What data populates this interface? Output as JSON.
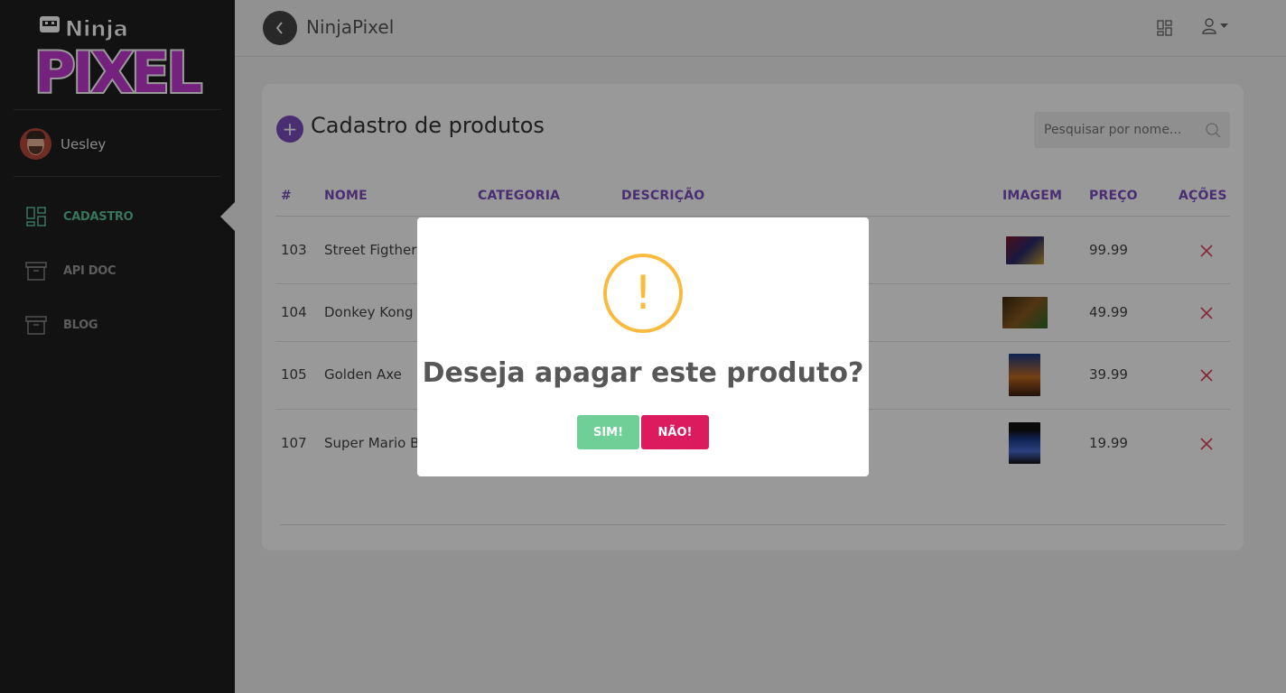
{
  "app": {
    "title": "NinjaPixel"
  },
  "logo": {
    "line1": "Ninja",
    "line2": "PIXEL"
  },
  "user": {
    "name": "Uesley"
  },
  "sidebar": {
    "items": [
      {
        "label": "CADASTRO",
        "icon": "dashboard-icon",
        "active": true
      },
      {
        "label": "API DOC",
        "icon": "archive-icon",
        "active": false
      },
      {
        "label": "BLOG",
        "icon": "archive-icon",
        "active": false
      }
    ]
  },
  "page": {
    "title": "Cadastro de produtos",
    "add_label": "+",
    "search_placeholder": "Pesquisar por nome..."
  },
  "table": {
    "columns": [
      "#",
      "NOME",
      "CATEGORIA",
      "DESCRIÇÃO",
      "IMAGEM",
      "PREÇO",
      "AÇÕES"
    ],
    "rows": [
      {
        "id": "103",
        "name": "Street Figther",
        "price": "99.99"
      },
      {
        "id": "104",
        "name": "Donkey Kong",
        "price": "49.99"
      },
      {
        "id": "105",
        "name": "Golden Axe",
        "price": "39.99"
      },
      {
        "id": "107",
        "name": "Super Mario Br",
        "price": "19.99"
      }
    ]
  },
  "modal": {
    "icon": "!",
    "title": "Deseja apagar este produto?",
    "confirm": "SIM!",
    "cancel": "NÃO!"
  },
  "colors": {
    "accent": "#7a4fbf",
    "active_nav": "#5cc49a",
    "warning": "#f8bb40",
    "confirm": "#6fcf97",
    "cancel": "#dc1b5e",
    "delete": "#e0405a"
  }
}
